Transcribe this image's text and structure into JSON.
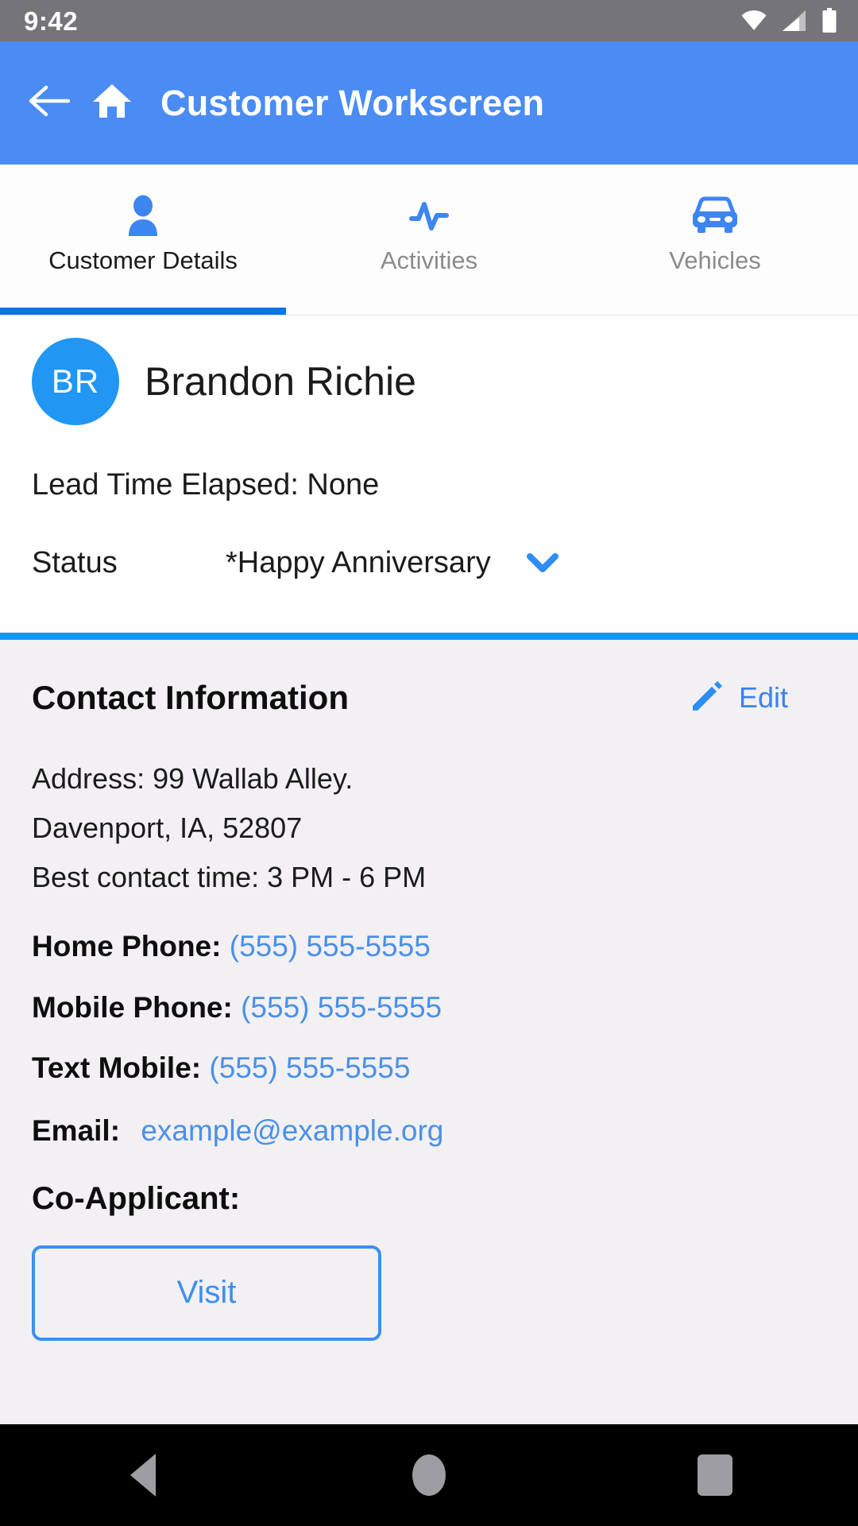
{
  "statusbar": {
    "clock": "9:42",
    "icons": [
      "wifi-icon",
      "cellular-signal-icon",
      "battery-icon"
    ]
  },
  "appbar": {
    "back_icon": "back-arrow-icon",
    "home_icon": "home-icon",
    "title": "Customer Workscreen",
    "background_color": "#4a8cf4"
  },
  "tabs": [
    {
      "label": "Customer Details",
      "icon": "person-icon",
      "active": true
    },
    {
      "label": "Activities",
      "icon": "activity-pulse-icon",
      "active": false
    },
    {
      "label": "Vehicles",
      "icon": "car-icon",
      "active": false
    }
  ],
  "customer": {
    "avatar_initials": "BR",
    "avatar_color": "#2196f3",
    "name": "Brandon Richie",
    "lead_time": "Lead Time Elapsed: None",
    "status_label": "Status",
    "status_value": "*Happy Anniversary",
    "status_chevron_icon": "chevron-down-icon"
  },
  "contact": {
    "title": "Contact Information",
    "edit_label": "Edit",
    "edit_icon": "pencil-edit-icon",
    "address_lines": [
      "Address: 99 Wallab Alley.",
      "Davenport, IA, 52807",
      "Best contact time: 3 PM - 6 PM"
    ],
    "phones": [
      {
        "label": "Home Phone:",
        "value": "(555) 555-5555"
      },
      {
        "label": "Mobile Phone:",
        "value": "(555) 555-5555"
      },
      {
        "label": "Text Mobile:",
        "value": "(555) 555-5555"
      }
    ],
    "email": {
      "label": "Email:",
      "value": "example@example.org"
    },
    "coapplicant_label": "Co-Applicant:",
    "visit_button": "Visit",
    "link_color": "#4a90e8",
    "background_color": "#f2f0f3"
  },
  "navbar": {
    "back": "nav-back-icon",
    "home": "nav-home-icon",
    "recents": "nav-recents-icon"
  }
}
